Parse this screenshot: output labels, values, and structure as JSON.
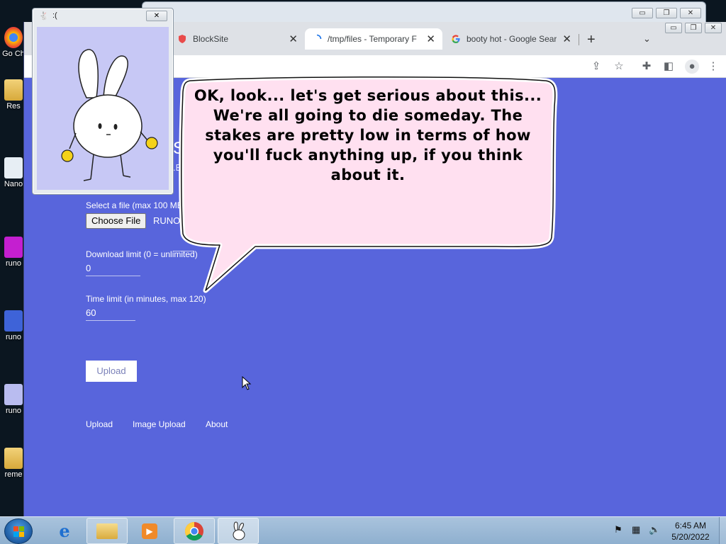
{
  "desktop": {
    "icons": [
      {
        "label": "Go Ch",
        "icon": "chrome-icon"
      },
      {
        "label": "Res",
        "icon": "folder-icon"
      },
      {
        "label": "Nano",
        "icon": "app-icon"
      },
      {
        "label": "runo",
        "icon": "bunny-icon"
      },
      {
        "label": "runo",
        "icon": "bunny-icon"
      },
      {
        "label": "runo",
        "icon": "bunny-icon"
      },
      {
        "label": "reme",
        "icon": "folder-icon"
      }
    ]
  },
  "browser": {
    "tabs": [
      {
        "title": "BlockSite",
        "icon": "shield-icon",
        "close": "✕"
      },
      {
        "title": "/tmp/files - Temporary F",
        "icon": "loading-icon",
        "close": "✕"
      },
      {
        "title": "booty hot - Google Sear",
        "icon": "google-icon",
        "close": "✕"
      }
    ],
    "new_tab": "+",
    "tab_search": "⌄",
    "omnibox_fragment": "g"
  },
  "page": {
    "header_fragment": "S",
    "subheader_fragment": ".E",
    "file_label": "Select a file (max 100 MB",
    "choose_file_button": "Choose File",
    "file_name": "RUNO",
    "download_limit_label": "Download limit (0 = unlimited)",
    "download_limit_value": "0",
    "time_limit_label": "Time limit (in minutes, max 120)",
    "time_limit_value": "60",
    "upload_button": "Upload",
    "footer_links": [
      "Upload",
      "Image Upload",
      "About"
    ]
  },
  "popup": {
    "title": ":(",
    "close": "✕"
  },
  "speech_bubble": {
    "text": "OK, look... let's get serious about this... We're all going to die someday. The stakes are pretty low in terms of how you'll fuck anything up, if you think about it."
  },
  "taskbar": {
    "apps": [
      "explorer-icon",
      "folder-icon",
      "media-player-icon",
      "chrome-icon",
      "bunny-icon"
    ],
    "time": "6:45 AM",
    "date": "5/20/2022"
  },
  "colors": {
    "page_background": "#5865dc",
    "popup_canvas": "#c7c8f5",
    "bubble_fill": "#ffe0f0"
  }
}
